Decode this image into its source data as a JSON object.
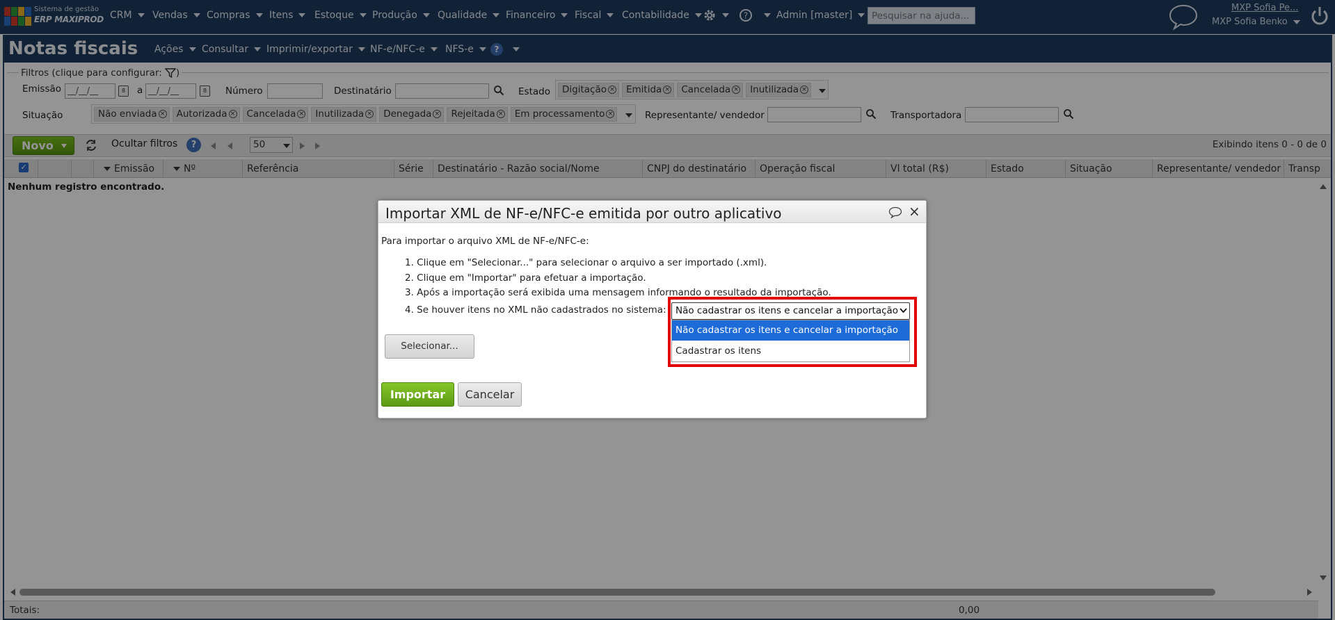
{
  "app": {
    "logo_line1": "Sistema de gestão",
    "logo_line2": "ERP MAXIPROD",
    "menu": [
      "CRM",
      "Vendas",
      "Compras",
      "Itens",
      "Estoque",
      "Produção",
      "Qualidade",
      "Financeiro",
      "Fiscal",
      "Contabilidade"
    ],
    "admin_label": "Admin [master]",
    "help_search_placeholder": "Pesquisar na ajuda...",
    "user_link": "MXP Sofia Pe...",
    "user_name": "MXP Sofia Benko"
  },
  "page": {
    "title": "Notas fiscais",
    "menu": [
      "Ações",
      "Consultar",
      "Imprimir/exportar",
      "NF-e/NFC-e",
      "NFS-e"
    ]
  },
  "filters": {
    "legend": "Filtros (clique para configurar:",
    "legend_end": ")",
    "emissao_label": "Emissão",
    "date_mask": "__/__/__",
    "range_sep": "a",
    "numero_label": "Número",
    "destinatario_label": "Destinatário",
    "estado_label": "Estado",
    "estado_tags": [
      "Digitação",
      "Emitida",
      "Cancelada",
      "Inutilizada"
    ],
    "situacao_label": "Situação",
    "situacao_tags": [
      "Não enviada",
      "Autorizada",
      "Cancelada",
      "Inutilizada",
      "Denegada",
      "Rejeitada",
      "Em processamento"
    ],
    "representante_label": "Representante/ vendedor",
    "transportadora_label": "Transportadora"
  },
  "toolbar": {
    "new_label": "Novo",
    "hide_filters": "Ocultar filtros",
    "page_size": "50",
    "status": "Exibindo itens 0 - 0 de 0"
  },
  "grid": {
    "columns": [
      "Emissão",
      "Nº",
      "Referência",
      "Série",
      "Destinatário - Razão social/Nome",
      "CNPJ do destinatário",
      "Operação fiscal",
      "Vl total (R$)",
      "Estado",
      "Situação",
      "Representante/ vendedor",
      "Transp"
    ],
    "empty_message": "Nenhum registro encontrado.",
    "totals_label": "Totais:",
    "totals_value": "0,00"
  },
  "dialog": {
    "title": "Importar XML de NF-e/NFC-e emitida por outro aplicativo",
    "intro": "Para importar o arquivo XML de NF-e/NFC-e:",
    "steps": [
      "1. Clique em \"Selecionar...\" para selecionar o arquivo a ser importado (.xml).",
      "2. Clique em \"Importar\" para efetuar a importação.",
      "3. Após a importação será exibida uma mensagem informando o resultado da importação.",
      "4. Se houver itens no XML não cadastrados no sistema:"
    ],
    "select_value": "Não cadastrar os itens e cancelar a importação",
    "options": [
      "Não cadastrar os itens e cancelar a importação",
      "Cadastrar os itens"
    ],
    "select_button": "Selecionar...",
    "import_button": "Importar",
    "cancel_button": "Cancelar"
  },
  "colors": {
    "nav_bg": "#1f3b5e",
    "accent_green": "#6aaf18",
    "selection_blue": "#1d6bd9",
    "highlight_red": "#e50000"
  }
}
